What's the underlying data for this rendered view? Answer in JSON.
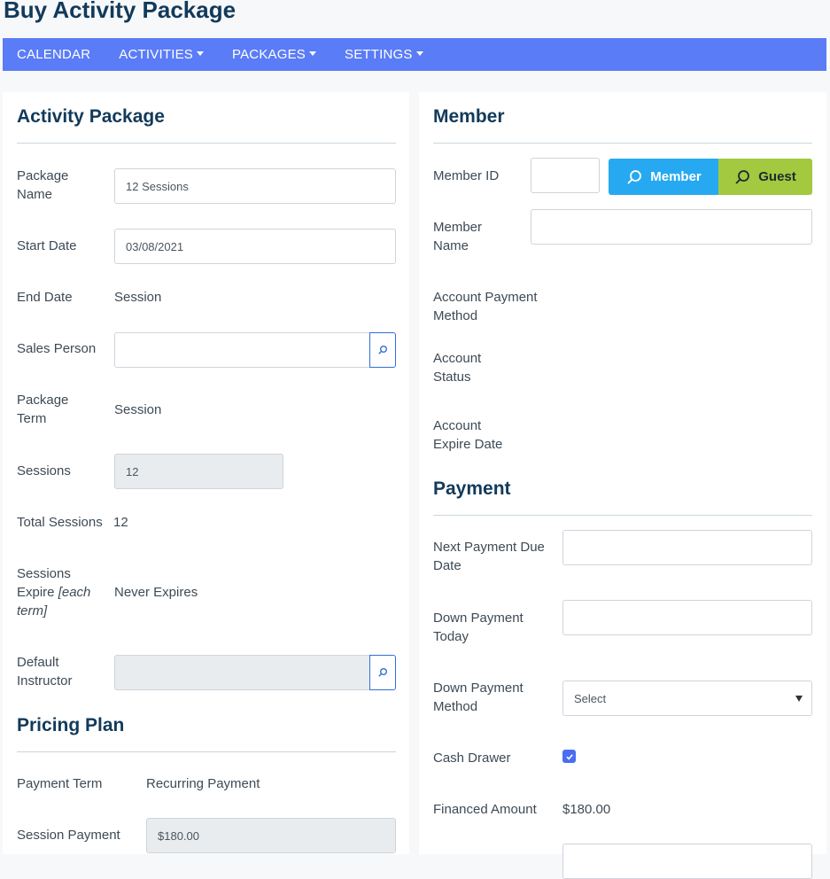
{
  "page": {
    "title": "Buy Activity Package"
  },
  "nav": {
    "calendar": "CALENDAR",
    "activities": "ACTIVITIES",
    "packages": "PACKAGES",
    "settings": "SETTINGS"
  },
  "activity_package": {
    "title": "Activity Package",
    "package_name_label": "Package Name",
    "package_name_value": "12 Sessions",
    "start_date_label": "Start Date",
    "start_date_value": "03/08/2021",
    "end_date_label": "End Date",
    "end_date_value": "Session",
    "sales_person_label": "Sales Person",
    "sales_person_value": "",
    "package_term_label": "Package Term",
    "package_term_value": "Session",
    "sessions_label": "Sessions",
    "sessions_value": "12",
    "total_sessions_label": "Total Sessions",
    "total_sessions_value": "12",
    "sessions_expire_label": "Sessions Expire",
    "sessions_expire_note": "[each term]",
    "sessions_expire_value": "Never Expires",
    "default_instructor_label": "Default Instructor",
    "default_instructor_value": ""
  },
  "pricing_plan": {
    "title": "Pricing Plan",
    "payment_term_label": "Payment Term",
    "payment_term_value": "Recurring Payment",
    "session_payment_label": "Session Payment",
    "session_payment_value": "$180.00"
  },
  "member": {
    "title": "Member",
    "member_id_label": "Member ID",
    "member_id_value": "",
    "member_button": "Member",
    "guest_button": "Guest",
    "member_name_label": "Member Name",
    "member_name_value": "",
    "account_payment_method_label": "Account Payment Method",
    "account_status_label": "Account Status",
    "account_expire_date_label": "Account Expire Date"
  },
  "payment": {
    "title": "Payment",
    "next_payment_due_label": "Next Payment Due Date",
    "next_payment_due_value": "",
    "down_payment_today_label": "Down Payment Today",
    "down_payment_today_value": "",
    "down_payment_method_label": "Down Payment Method",
    "down_payment_method_value": "Select",
    "cash_drawer_label": "Cash Drawer",
    "cash_drawer_checked": true,
    "financed_amount_label": "Financed Amount",
    "financed_amount_value": "$180.00"
  },
  "colors": {
    "navbar": "#5b7cf7",
    "title": "#123a5a",
    "member_button": "#27a9f1",
    "guest_button": "#a2c93f",
    "search_addon_border": "#2f6fd6",
    "checkbox": "#4a6ef0"
  },
  "icons": {
    "search": "search-icon",
    "caret": "caret-down-icon",
    "check": "check-icon"
  }
}
